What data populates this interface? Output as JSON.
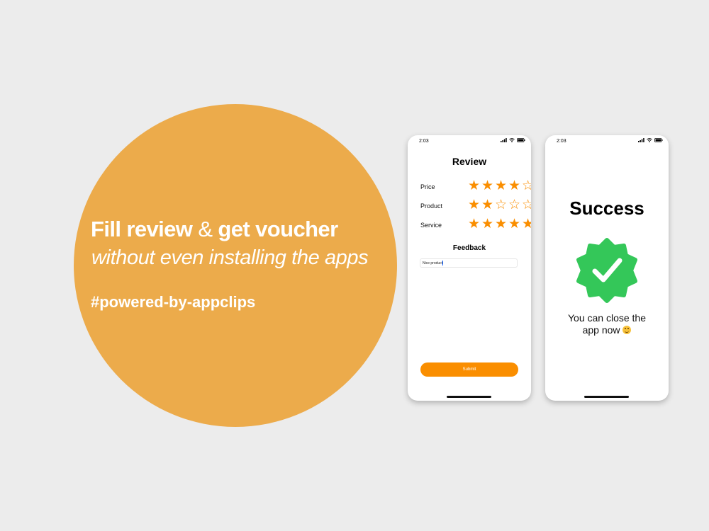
{
  "promo": {
    "headline_part1": "Fill review",
    "headline_amp": "&",
    "headline_part2": "get voucher",
    "subline": "without even installing the apps",
    "hashtag": "#powered-by-appclips",
    "circle_color": "#ecab4b"
  },
  "review_screen": {
    "status_time": "2:03",
    "title": "Review",
    "ratings": [
      {
        "label": "Price",
        "stars": 4,
        "max": 5
      },
      {
        "label": "Product",
        "stars": 2,
        "max": 5
      },
      {
        "label": "Service",
        "stars": 5,
        "max": 5
      }
    ],
    "feedback_title": "Feedback",
    "feedback_value": "Nice product",
    "submit_label": "Submit",
    "accent_color": "#fa8e00"
  },
  "success_screen": {
    "status_time": "2:03",
    "title": "Success",
    "message_line1": "You can close the",
    "message_line2": "app now",
    "badge_icon": "verified-check-badge",
    "badge_color": "#34c759"
  }
}
